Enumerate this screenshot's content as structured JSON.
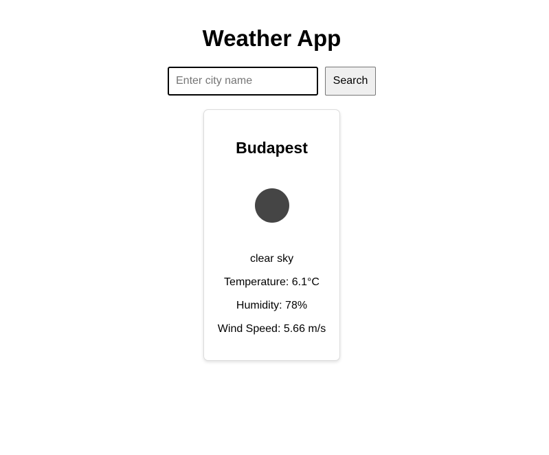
{
  "header": {
    "title": "Weather App"
  },
  "search": {
    "placeholder": "Enter city name",
    "value": "",
    "button_label": "Search"
  },
  "weather": {
    "city": "Budapest",
    "icon": "weather-condition-icon",
    "description": "clear sky",
    "temperature_text": "Temperature: 6.1°C",
    "humidity_text": "Humidity: 78%",
    "wind_text": "Wind Speed: 5.66 m/s"
  },
  "colors": {
    "icon_fill": "#454545",
    "card_border": "#dcdcdc",
    "button_bg": "#efefef"
  }
}
